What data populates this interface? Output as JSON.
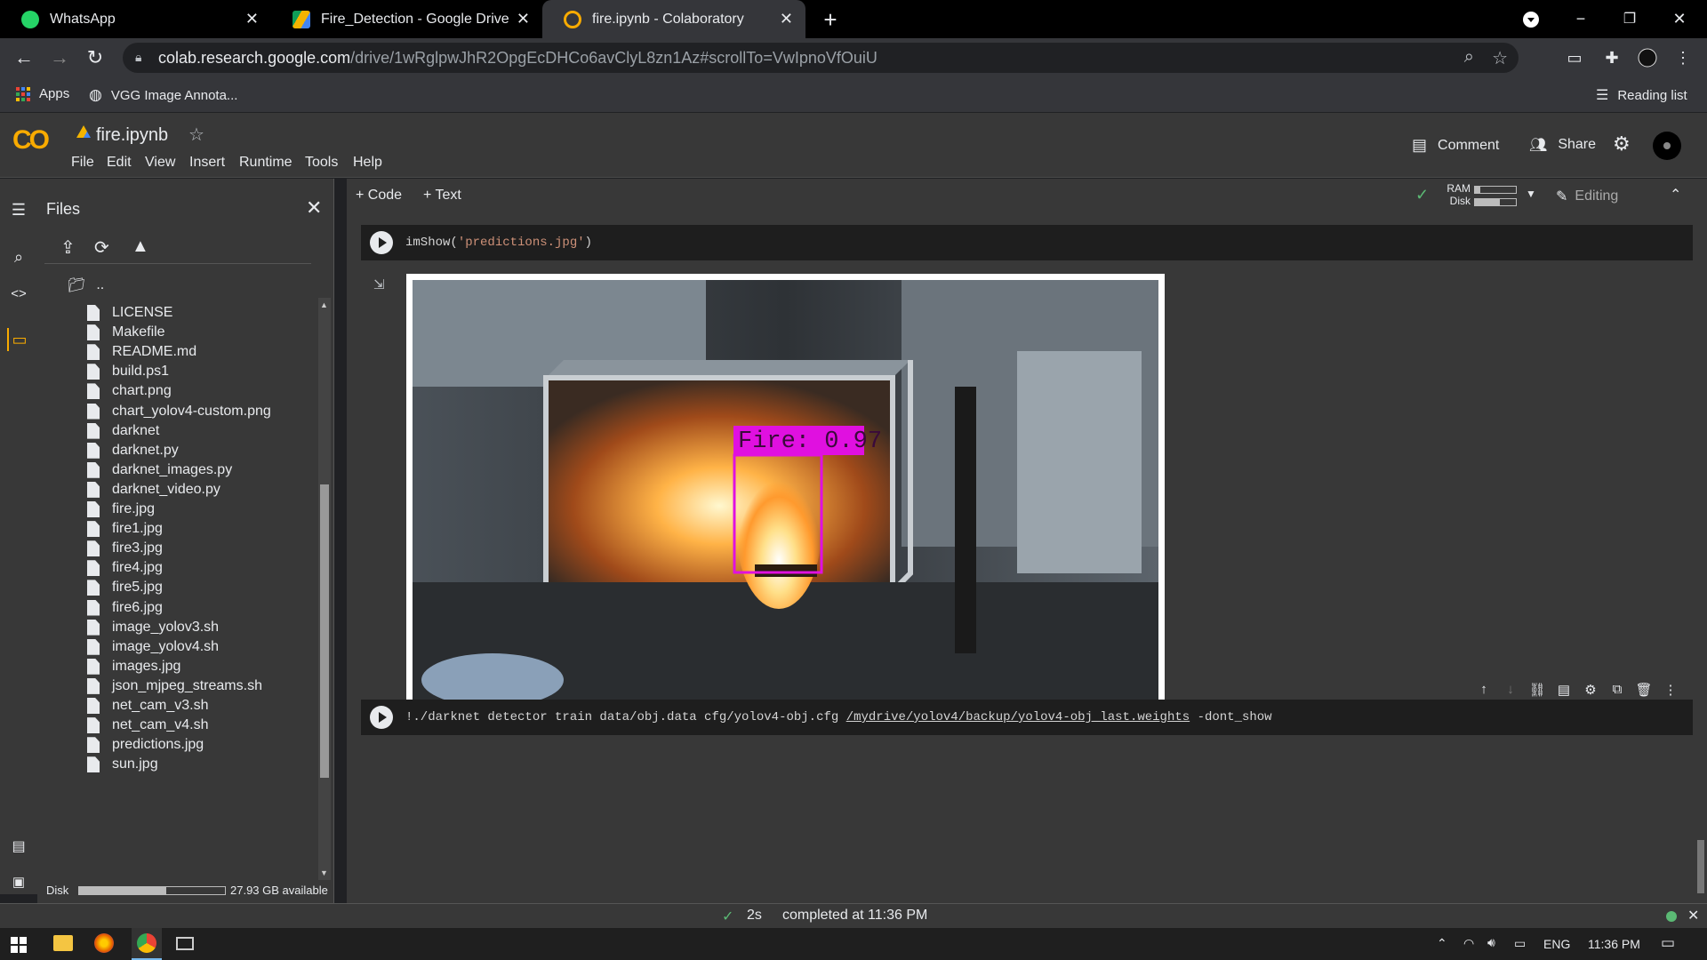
{
  "browser": {
    "tabs": [
      {
        "label": "WhatsApp",
        "icon": "whatsapp-icon",
        "active": false
      },
      {
        "label": "Fire_Detection - Google Drive",
        "icon": "google-drive-icon",
        "active": false
      },
      {
        "label": "fire.ipynb - Colaboratory",
        "icon": "colab-icon",
        "active": true
      }
    ],
    "url_host": "colab.research.google.com",
    "url_path": "/drive/1wRglpwJhR2OpgEcDHCo6avClyL8zn1Az#scrollTo=VwIpnoVfOuiU",
    "bookmarks": [
      {
        "label": "Apps",
        "icon": "apps-grid-icon"
      },
      {
        "label": "VGG Image Annota...",
        "icon": "globe-icon"
      }
    ],
    "reading_list_label": "Reading list"
  },
  "colab": {
    "logo_text": "CO",
    "notebook_title": "fire.ipynb",
    "menu": [
      "File",
      "Edit",
      "View",
      "Insert",
      "Runtime",
      "Tools",
      "Help"
    ],
    "comment_label": "Comment",
    "share_label": "Share",
    "add_code_label": "+ Code",
    "add_text_label": "+ Text",
    "ram_label": "RAM",
    "disk_label": "Disk",
    "editing_label": "Editing"
  },
  "files": {
    "title": "Files",
    "parent_label": "..",
    "items": [
      "LICENSE",
      "Makefile",
      "README.md",
      "build.ps1",
      "chart.png",
      "chart_yolov4-custom.png",
      "darknet",
      "darknet.py",
      "darknet_images.py",
      "darknet_video.py",
      "fire.jpg",
      "fire1.jpg",
      "fire3.jpg",
      "fire4.jpg",
      "fire5.jpg",
      "fire6.jpg",
      "image_yolov3.sh",
      "image_yolov4.sh",
      "images.jpg",
      "json_mjpeg_streams.sh",
      "net_cam_v3.sh",
      "net_cam_v4.sh",
      "predictions.jpg",
      "sun.jpg"
    ],
    "disk_label": "Disk",
    "disk_available": "27.93 GB available",
    "disk_used_fraction": 0.6
  },
  "cells": {
    "cell1_fn": "imShow(",
    "cell1_str": "'predictions.jpg'",
    "cell1_close": ")",
    "detection_label": "Fire: 0.97",
    "cell2_prefix": "!./darknet detector train data/obj.data cfg/yolov4-obj.cfg",
    "cell2_path": "/mydrive/yolov4/backup/yolov4-obj_last.weights",
    "cell2_suffix": "-dont_show"
  },
  "status": {
    "duration": "2s",
    "completed": "completed at 11:36 PM"
  },
  "taskbar": {
    "lang": "ENG",
    "time": "11:36 PM"
  },
  "colors": {
    "detection_box": "#e010e0",
    "accent_orange": "#f9ab00",
    "check_green": "#5bb974"
  }
}
